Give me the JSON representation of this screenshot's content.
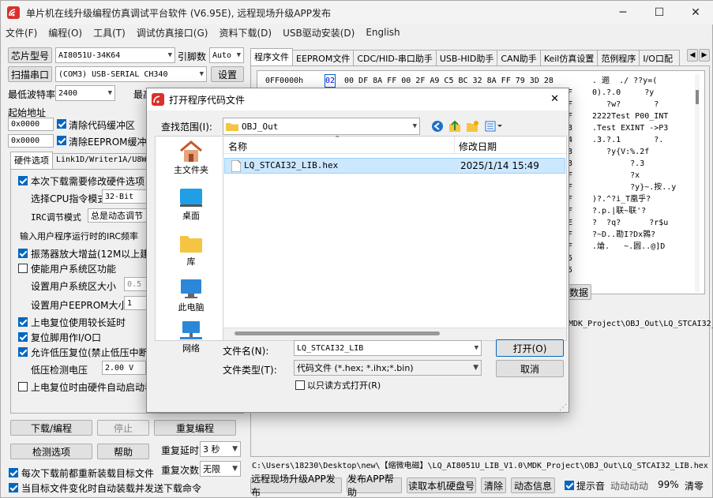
{
  "window": {
    "title": "单片机在线升级编程仿真调试平台软件 (V6.95E), 远程现场升级APP发布",
    "minimize": "─",
    "maximize": "☐",
    "close": "✕"
  },
  "menu": [
    "文件(F)",
    "编程(O)",
    "工具(T)",
    "调试仿真接口(G)",
    "资料下载(D)",
    "USB驱动安装(D)",
    "English"
  ],
  "left": {
    "chip_label": "芯片型号",
    "chip_value": "AI8051U-34K64",
    "pin_label": "引脚数",
    "pin_value": "Auto",
    "scan_port_btn": "扫描串口",
    "port_value": "(COM3) USB-SERIAL CH340",
    "settings_btn": "设置",
    "min_baud_label": "最低波特率",
    "min_baud_value": "2400",
    "max_baud_label": "最高",
    "start_addr_label": "起始地址",
    "addr1_value": "0x0000",
    "clear_code_label": "清除代码缓冲区",
    "addr2_value": "0x0000",
    "clear_eeprom_label": "清除EEPROM缓冲区",
    "tabs": [
      "硬件选项",
      "Link1D/Writer1A/U8W"
    ],
    "options": {
      "need_modify": "本次下载需要修改硬件选项",
      "cpu_mode_label": "选择CPU指令模式",
      "cpu_mode_value": "32-Bit",
      "irc_mode_label": "IRC调节模式",
      "irc_mode_value": "总是动态调节",
      "irc_freq_label": "输入用户程序运行时的IRC频率",
      "osc_gain": "振荡器放大增益(12M以上建议",
      "user_sys_area": "使能用户系统区功能",
      "sys_size_label": "设置用户系统区大小",
      "sys_size_value": "0.5",
      "eeprom_size_label": "设置用户EEPROM大小",
      "eeprom_size_value": "1",
      "por_delay": "上电复位使用较长延时",
      "reset_io": "复位脚用作I/O口",
      "low_volt_reset": "允许低压复位(禁止低压中断",
      "low_volt_label": "低压检测电压",
      "low_volt_value": "2.00 V",
      "por_hw": "上电复位时由硬件自动启动看"
    },
    "download_btn": "下载/编程",
    "stop_btn": "停止",
    "reprogram_btn": "重复编程",
    "check_opts_btn": "检测选项",
    "help_btn": "帮助",
    "repeat_delay_label": "重复延时",
    "repeat_delay_value": "3 秒",
    "repeat_count_label": "重复次数",
    "repeat_count_value": "无限",
    "reload_label": "每次下载前都重新装载目标文件",
    "auto_send_label": "当目标文件变化时自动装载并发送下载命令"
  },
  "right": {
    "tabs": [
      "程序文件",
      "EEPROM文件",
      "CDC/HID-串口助手",
      "USB-HID助手",
      "CAN助手",
      "Keil仿真设置",
      "范例程序",
      "I/O口配"
    ],
    "hex": {
      "addr": "0FF0000h",
      "bytes": "02 00 DF 8A FF 00 2F A9 C5 BC 32 8A FF 79 3D 28",
      "selected_byte": "02",
      "ascii_rows": [
        ". 逦  ./ ??y=(",
        "0).?.0     ?y",
        "   ?w?       ?",
        "2222Test P00_INT",
        ".Test EXINT ->P3",
        ".3.?.1       ?.",
        "   ?y{V:%.2f",
        "",
        "        ?.3",
        "        ?x",
        "        ?y}~.按..y",
        ")?.^?i_T凰乎?",
        "?.p.|联~联'?",
        "?  ?q?      ?r$u",
        "?~D..勘I?Dx鶉?",
        ".熗.   ~.圆..@]D"
      ],
      "right_col": [
        "F",
        "F",
        "F",
        "3",
        "4",
        "3",
        "3",
        "F",
        "F",
        "F",
        "F",
        "E",
        "F",
        "F",
        "5",
        "5"
      ]
    },
    "data_btn": "数据",
    "path_partial": "MDK_Project\\OBJ_Out\\LQ_STCAI32_",
    "status_path": "C:\\Users\\18230\\Desktop\\new\\【缩微电磁】\\LQ_AI8051U_LIB_V1.0\\MDK_Project\\OBJ_Out\\LQ_STCAI32_LIB.hex",
    "bottom_buttons": [
      "远程现场升级APP发布",
      "发布APP帮助",
      "读取本机硬盘号",
      "清除",
      "动态信息"
    ],
    "hint_label": "提示音",
    "dyn_label": "动动动动",
    "pct_label": "99%",
    "clear_label": "清零"
  },
  "dialog": {
    "title": "打开程序代码文件",
    "lookin_label": "查找范围(I):",
    "lookin_value": "OBJ_Out",
    "nav": [
      "主文件夹",
      "桌面",
      "库",
      "此电脑",
      "网络"
    ],
    "col_name": "名称",
    "col_date": "修改日期",
    "files": [
      {
        "name": "LQ_STCAI32_LIB.hex",
        "date": "2025/1/14 15:49"
      }
    ],
    "filename_label": "文件名(N):",
    "filename_value": "LQ_STCAI32_LIB",
    "filetype_label": "文件类型(T):",
    "filetype_value": "代码文件 (*.hex;  *.ihx;*.bin)",
    "readonly_label": "以只读方式打开(R)",
    "open_btn": "打开(O)",
    "cancel_btn": "取消"
  },
  "colors": {
    "accent": "#0067c0",
    "selection": "#cce8ff",
    "folder": "#f6c443",
    "link_blue": "#0000ff"
  }
}
